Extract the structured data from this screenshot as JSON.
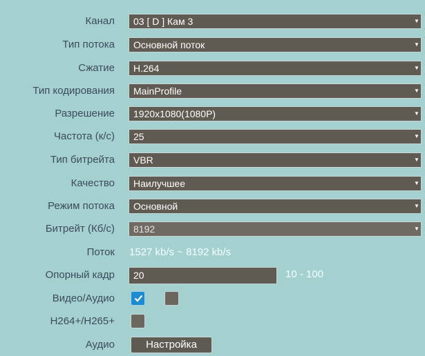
{
  "fields": {
    "channel": {
      "label": "Канал",
      "value": "03 [ D ] Кам 3"
    },
    "stream_type": {
      "label": "Тип потока",
      "value": "Основной поток"
    },
    "compression": {
      "label": "Сжатие",
      "value": "H.264"
    },
    "encoding_type": {
      "label": "Тип кодирования",
      "value": "MainProfile"
    },
    "resolution": {
      "label": "Разрешение",
      "value": "1920x1080(1080P)"
    },
    "frame_rate": {
      "label": "Частота (к/с)",
      "value": "25"
    },
    "bitrate_type": {
      "label": "Тип битрейта",
      "value": "VBR"
    },
    "quality": {
      "label": "Качество",
      "value": "Наилучшее"
    },
    "stream_mode": {
      "label": "Режим потока",
      "value": "Основной"
    },
    "bitrate": {
      "label": "Битрейт (Кб/с)",
      "value": "8192"
    },
    "stream": {
      "label": "Поток",
      "value": "1527 kb/s ~ 8192 kb/s"
    },
    "keyframe": {
      "label": "Опорный кадр",
      "value": "20",
      "range": "10 - 100"
    },
    "video_audio": {
      "label": "Видео/Аудио",
      "video_checked": true,
      "audio_checked": false
    },
    "h264plus": {
      "label": "H264+/H265+",
      "checked": false
    },
    "audio": {
      "label": "Аудио",
      "button_label": "Настройка"
    }
  },
  "icons": {
    "dropdown_arrow": "chevron-down-icon",
    "check": "check-icon"
  },
  "colors": {
    "background": "#a4d0d0",
    "control": "#5f5a52",
    "checked": "#1e8bd0"
  }
}
